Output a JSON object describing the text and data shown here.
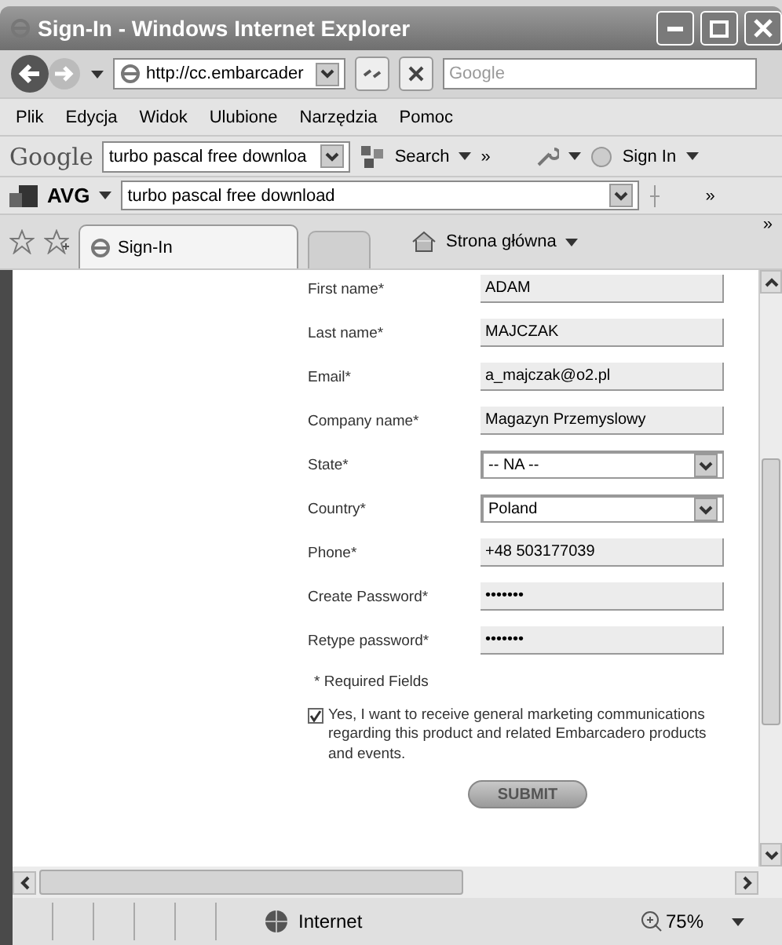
{
  "window": {
    "title": "Sign-In - Windows Internet Explorer"
  },
  "address_bar": {
    "url": "http://cc.embarcader",
    "search_placeholder": "Google"
  },
  "menu": [
    "Plik",
    "Edycja",
    "Widok",
    "Ulubione",
    "Narzędzia",
    "Pomoc"
  ],
  "google_toolbar": {
    "brand": "Google",
    "query": "turbo pascal free downloa",
    "search": "Search",
    "more": "»",
    "sign_in": "Sign In"
  },
  "avg_toolbar": {
    "brand": "AVG",
    "query": "turbo pascal free download",
    "more": "»"
  },
  "tabs": [
    {
      "label": "Sign-In",
      "selected": true
    }
  ],
  "home": {
    "label": "Strona główna",
    "more": "»"
  },
  "form": {
    "fields": [
      {
        "label": "First name*",
        "kind": "text",
        "value": "ADAM"
      },
      {
        "label": "Last name*",
        "kind": "text",
        "value": "MAJCZAK"
      },
      {
        "label": "Email*",
        "kind": "text",
        "value": "a_majczak@o2.pl"
      },
      {
        "label": "Company name*",
        "kind": "text",
        "value": "Magazyn Przemyslowy"
      },
      {
        "label": "State*",
        "kind": "select",
        "value": "-- NA --"
      },
      {
        "label": "Country*",
        "kind": "select",
        "value": "Poland"
      },
      {
        "label": "Phone*",
        "kind": "text",
        "value": "+48 503177039"
      },
      {
        "label": "Create Password*",
        "kind": "password",
        "value": "•••••••"
      },
      {
        "label": "Retype password*",
        "kind": "password",
        "value": "•••••••"
      }
    ],
    "required_note": "* Required Fields",
    "consent": {
      "checked": true,
      "text": "Yes, I want to receive general marketing communications regarding this product and related Embarcadero products and events."
    },
    "submit": "SUBMIT"
  },
  "status_bar": {
    "zone": "Internet",
    "zoom": "75%"
  }
}
